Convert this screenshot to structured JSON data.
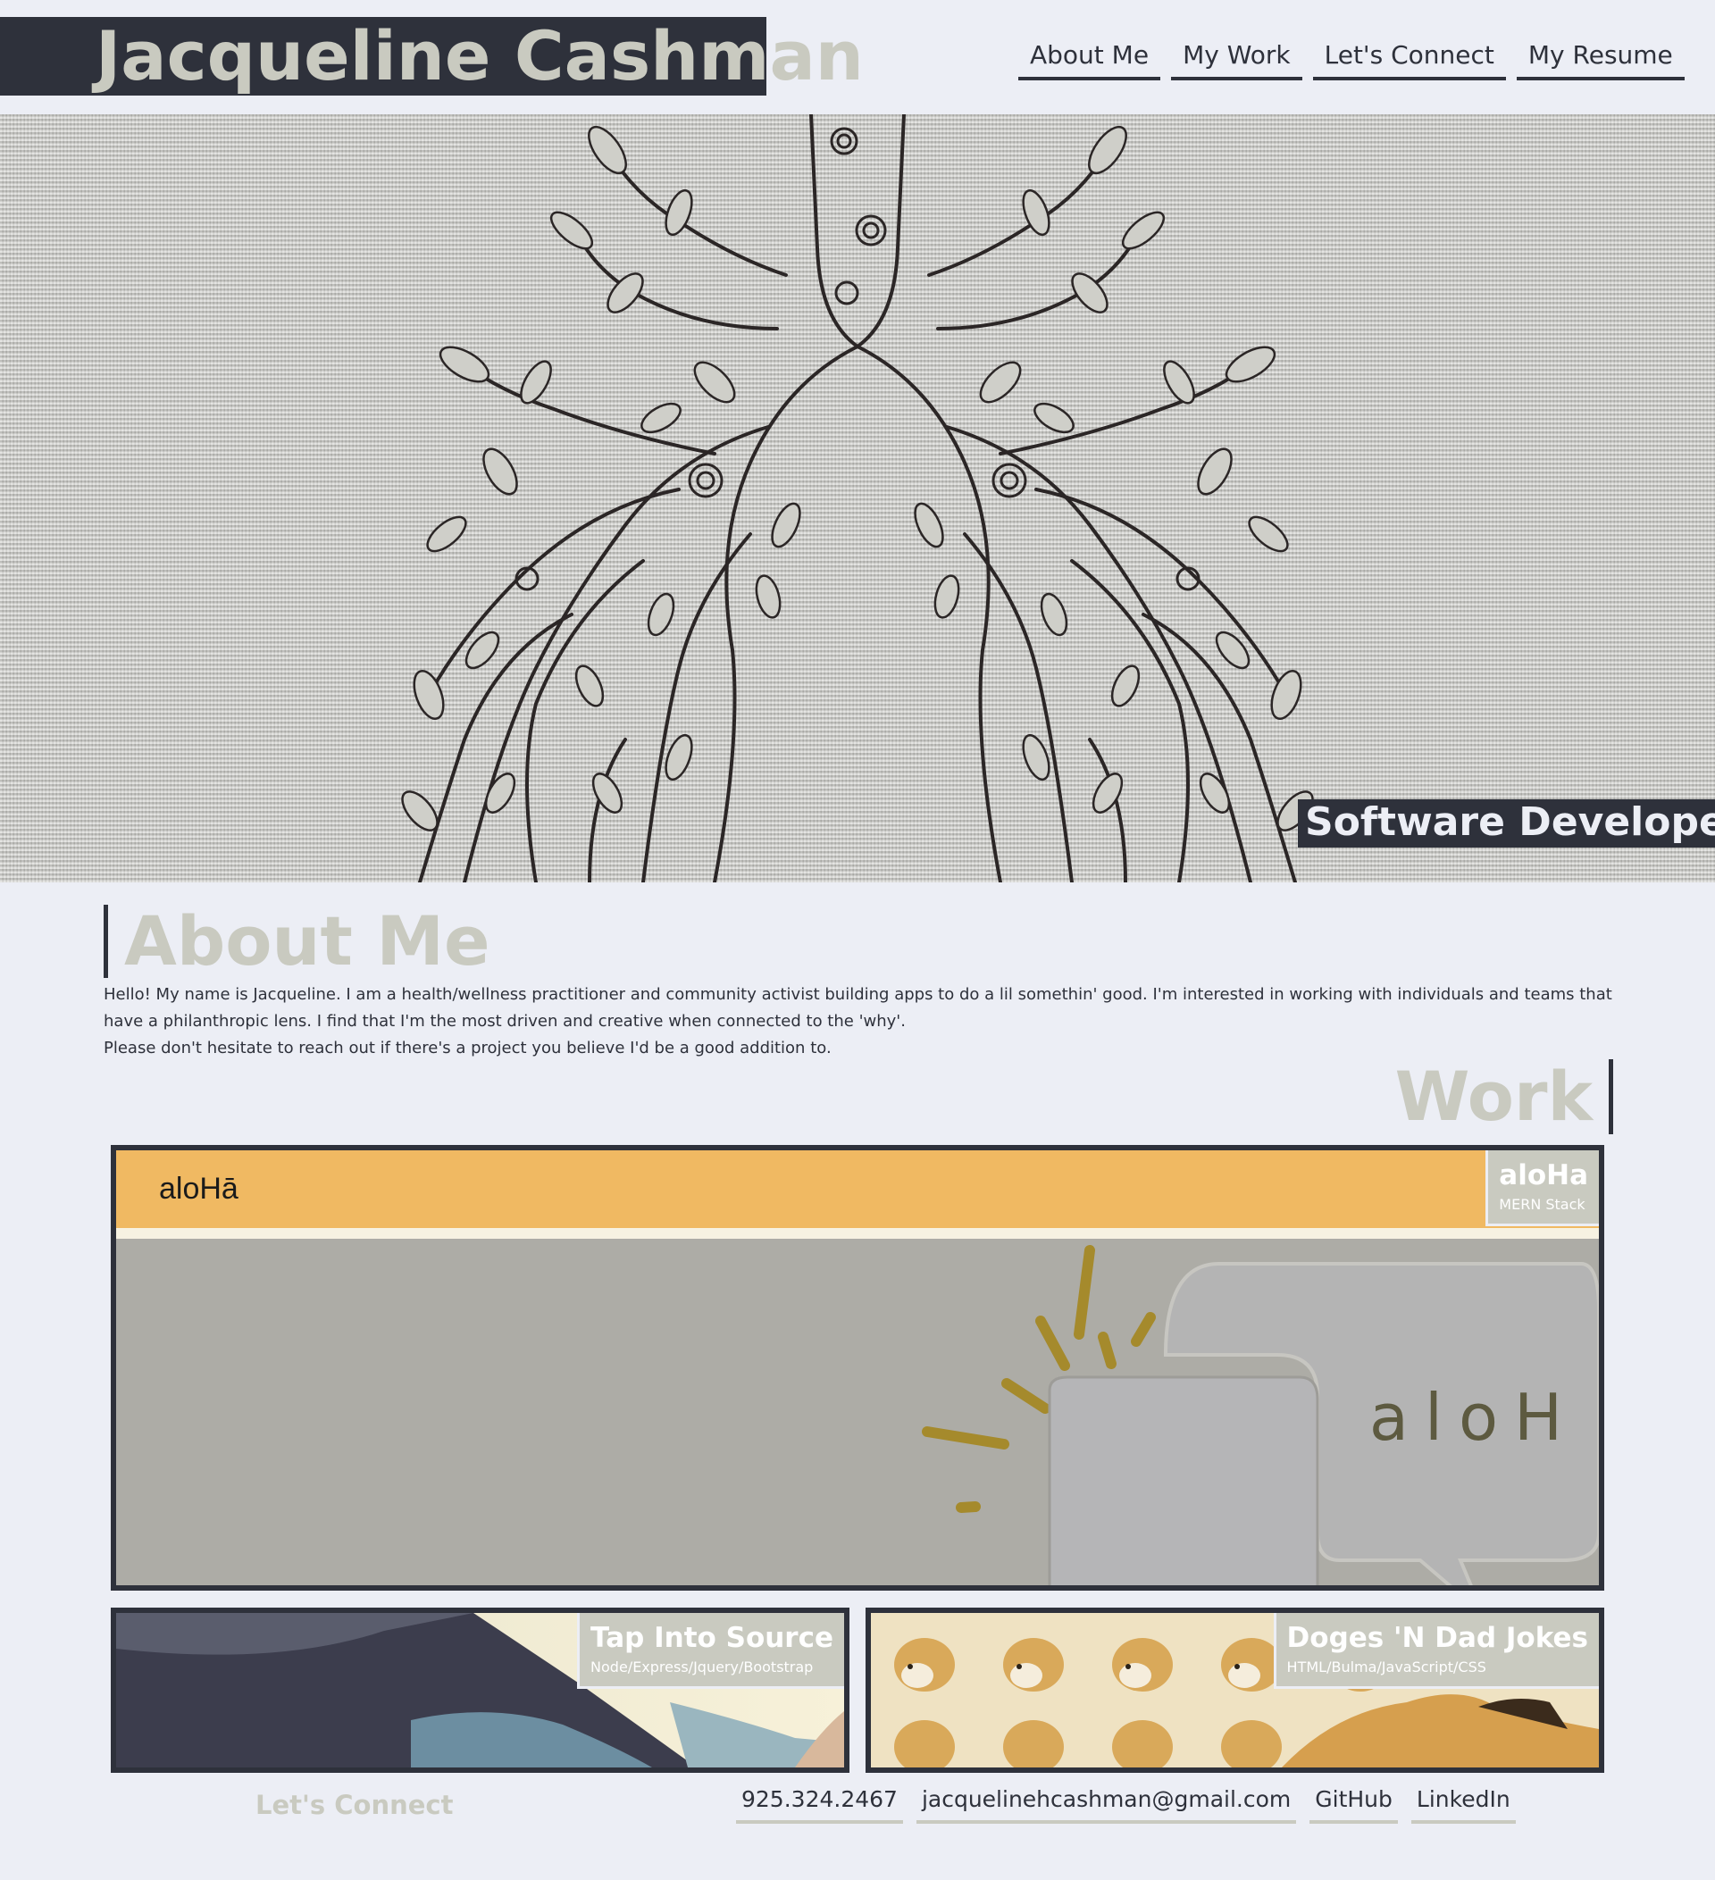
{
  "header": {
    "title": "Jacqueline Cashman",
    "nav": [
      {
        "label": "About Me"
      },
      {
        "label": "My Work"
      },
      {
        "label": "Let's Connect"
      },
      {
        "label": "My Resume"
      }
    ]
  },
  "hero": {
    "tagline": "Software Developer",
    "image": "lungs-tree-illustration"
  },
  "about": {
    "heading": "About Me",
    "paragraph_1": "Hello! My name is Jacqueline. I am a health/wellness practitioner and community activist building apps to do a lil somethin' good. I'm interested in working with individuals and teams that have a philanthropic lens. I find that I'm the most driven and creative when connected to the 'why'.",
    "paragraph_2": "Please don't hesitate to reach out if there's a project you believe I'd be a good addition to."
  },
  "work": {
    "heading": "Work",
    "projects": [
      {
        "title": "aloHa",
        "tech": "MERN Stack",
        "preview_logo": "aloHā",
        "preview_watermark": "aloH"
      },
      {
        "title": "Tap Into Source",
        "tech": "Node/Express/Jquery/Bootstrap"
      },
      {
        "title": "Doges 'N Dad Jokes",
        "tech": "HTML/Bulma/JavaScript/CSS"
      }
    ]
  },
  "connect": {
    "heading": "Let's Connect",
    "links": [
      {
        "label": "925.324.2467"
      },
      {
        "label": "jacquelinehcashman@gmail.com"
      },
      {
        "label": "GitHub"
      },
      {
        "label": "LinkedIn"
      }
    ]
  },
  "colors": {
    "dark": "#2e313b",
    "page_bg": "#eceef5",
    "sage": "#c9cac0",
    "aloha_orange": "#f0b962"
  }
}
